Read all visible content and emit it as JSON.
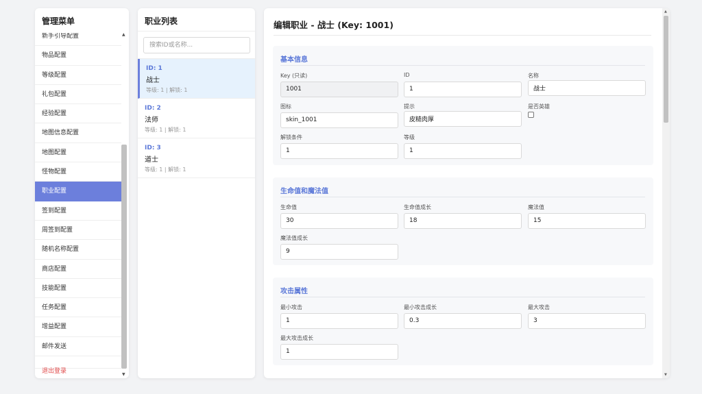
{
  "sidebar": {
    "title": "管理菜单",
    "items": [
      "新手引导配置",
      "物品配置",
      "等级配置",
      "礼包配置",
      "经验配置",
      "地图信息配置",
      "地图配置",
      "怪物配置",
      "职业配置",
      "签到配置",
      "周签到配置",
      "随机名称配置",
      "商店配置",
      "技能配置",
      "任务配置",
      "增益配置",
      "邮件发送"
    ],
    "active_index": 8,
    "logout": "退出登录"
  },
  "job_list": {
    "title": "职业列表",
    "search_placeholder": "搜索ID或名称...",
    "jobs": [
      {
        "id": "ID: 1",
        "name": "战士",
        "meta": "等级: 1 | 解锁: 1"
      },
      {
        "id": "ID: 2",
        "name": "法师",
        "meta": "等级: 1 | 解锁: 1"
      },
      {
        "id": "ID: 3",
        "name": "道士",
        "meta": "等级: 1 | 解锁: 1"
      }
    ],
    "selected_index": 0
  },
  "editor": {
    "title": "编辑职业 - 战士 (Key: 1001)",
    "basic": {
      "title": "基本信息",
      "key_label": "Key (只读)",
      "key_value": "1001",
      "id_label": "ID",
      "id_value": "1",
      "name_label": "名称",
      "name_value": "战士",
      "icon_label": "图标",
      "icon_value": "skin_1001",
      "hint_label": "提示",
      "hint_value": "皮糙肉厚",
      "hero_label": "是否英雄",
      "unlock_label": "解锁条件",
      "unlock_value": "1",
      "level_label": "等级",
      "level_value": "1"
    },
    "hpmp": {
      "title": "生命值和魔法值",
      "hp_label": "生命值",
      "hp_value": "30",
      "hp_growth_label": "生命值成长",
      "hp_growth_value": "18",
      "mp_label": "魔法值",
      "mp_value": "15",
      "mp_growth_label": "魔法值成长",
      "mp_growth_value": "9"
    },
    "attack": {
      "title": "攻击属性",
      "min_atk_label": "最小攻击",
      "min_atk_value": "1",
      "min_atk_growth_label": "最小攻击成长",
      "min_atk_growth_value": "0.3",
      "max_atk_label": "最大攻击",
      "max_atk_value": "3",
      "max_atk_growth_label": "最大攻击成长",
      "max_atk_growth_value": "1"
    }
  },
  "colors": {
    "accent": "#6c7fdc",
    "section_title": "#5b78d8",
    "logout": "#e04b4b"
  }
}
